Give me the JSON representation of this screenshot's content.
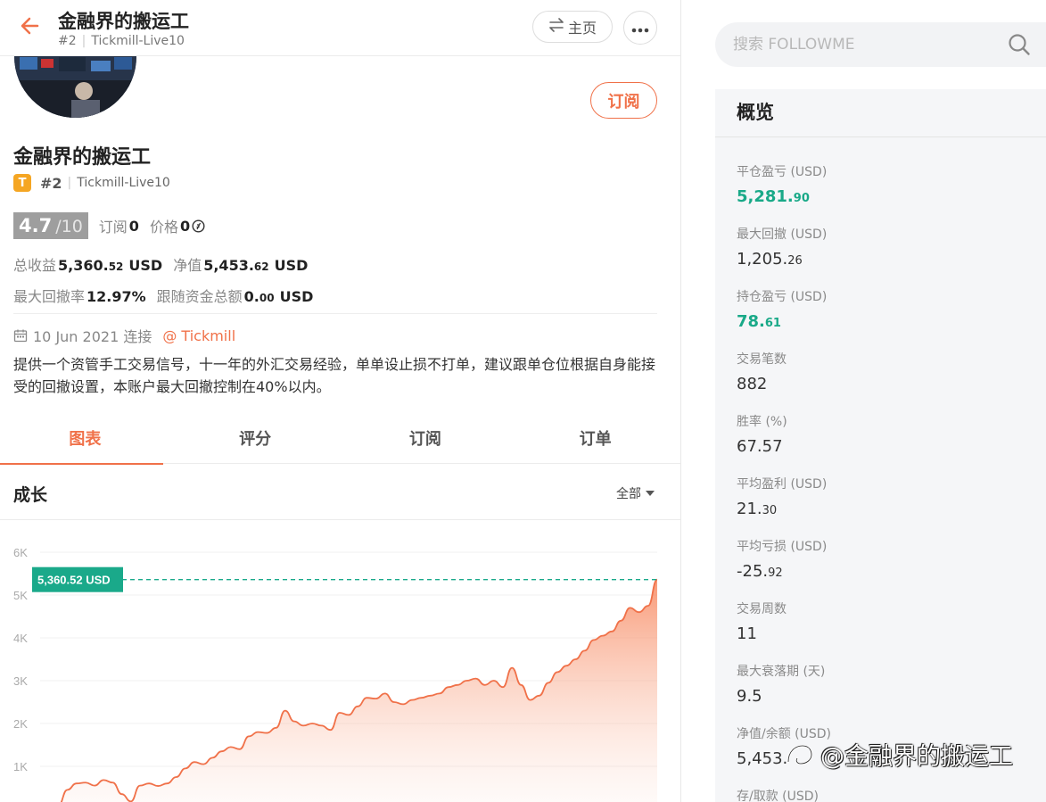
{
  "topbar": {
    "title": "金融界的搬运工",
    "rank": "#2",
    "broker": "Tickmill-Live10",
    "home_label": "主页"
  },
  "profile": {
    "subscribe_label": "订阅",
    "name": "金融界的搬运工",
    "badge": "T",
    "rank": "#2",
    "broker": "Tickmill-Live10",
    "score": "4.7",
    "score_max": "/10",
    "subs_label": "订阅",
    "subs_value": "0",
    "price_label": "价格",
    "price_value": "0",
    "total_profit_label": "总收益",
    "total_profit_int": "5,360.",
    "total_profit_dec": "52",
    "total_profit_unit": "USD",
    "equity_label": "净值",
    "equity_int": "5,453.",
    "equity_dec": "62",
    "equity_unit": "USD",
    "max_dd_label": "最大回撤率",
    "max_dd_value": "12.97%",
    "follow_funds_label": "跟随资金总额",
    "follow_funds_int": "0.",
    "follow_funds_dec": "00",
    "follow_funds_unit": "USD",
    "connect_date": "10 Jun 2021 连接",
    "connect_link": "@ Tickmill",
    "description": "提供一个资管手工交易信号，十一年的外汇交易经验，单单设止损不打单，建议跟单仓位根据自身能接受的回撤设置，本账户最大回撤控制在40%以内。"
  },
  "tabs": [
    {
      "label": "图表",
      "active": true
    },
    {
      "label": "评分",
      "active": false
    },
    {
      "label": "订阅",
      "active": false
    },
    {
      "label": "订单",
      "active": false
    }
  ],
  "growth": {
    "title": "成长",
    "filter": "全部"
  },
  "chart_data": {
    "type": "area",
    "title": "",
    "xlabel": "",
    "ylabel": "",
    "ylim": [
      0,
      6000
    ],
    "yticks": [
      "1K",
      "2K",
      "3K",
      "4K",
      "5K",
      "6K"
    ],
    "current_label": "5,360.52 USD",
    "current_value": 5360.52,
    "colors": {
      "line": "#f07149",
      "fill": "#f9a07f",
      "marker": "#1aa98a"
    },
    "values": [
      0,
      120,
      80,
      450,
      600,
      620,
      550,
      680,
      620,
      350,
      180,
      550,
      600,
      540,
      600,
      750,
      950,
      1100,
      1050,
      1200,
      1350,
      1450,
      1400,
      1700,
      1800,
      1780,
      1900,
      2300,
      2050,
      1950,
      2000,
      1950,
      1850,
      2250,
      2200,
      2400,
      2600,
      2580,
      2700,
      2500,
      2450,
      2550,
      2600,
      2650,
      2700,
      2850,
      2900,
      3000,
      3050,
      2900,
      3000,
      2850,
      3300,
      2900,
      2550,
      2650,
      2950,
      3200,
      3350,
      3500,
      3700,
      3950,
      4050,
      4150,
      4400,
      4700,
      4600,
      4750,
      5360.52
    ]
  },
  "search": {
    "placeholder": "搜索 FOLLOWME"
  },
  "overview": {
    "title": "概览",
    "items": [
      {
        "label": "平仓盈亏 (USD)",
        "int": "5,281.",
        "dec": "90",
        "green": true
      },
      {
        "label": "最大回撤 (USD)",
        "int": "1,205.",
        "dec": "26",
        "green": false
      },
      {
        "label": "持仓盈亏 (USD)",
        "int": "78.",
        "dec": "61",
        "green": true
      },
      {
        "label": "交易笔数",
        "int": "882",
        "dec": "",
        "green": false
      },
      {
        "label": "胜率 (%)",
        "int": "67.57",
        "dec": "",
        "green": false
      },
      {
        "label": "平均盈利 (USD)",
        "int": "21.",
        "dec": "30",
        "green": false
      },
      {
        "label": "平均亏损 (USD)",
        "int": "-25.",
        "dec": "92",
        "green": false
      },
      {
        "label": "交易周数",
        "int": "11",
        "dec": "",
        "green": false
      },
      {
        "label": "最大衰落期 (天)",
        "int": "9.5",
        "dec": "",
        "green": false
      },
      {
        "label": "净值/余额 (USD)",
        "int": "5,453.",
        "dec": "",
        "green": false
      },
      {
        "label": "存/取款 (USD)",
        "int": "",
        "dec": "",
        "green": false
      }
    ]
  },
  "watermark": {
    "text": "@金融界的搬运工"
  }
}
